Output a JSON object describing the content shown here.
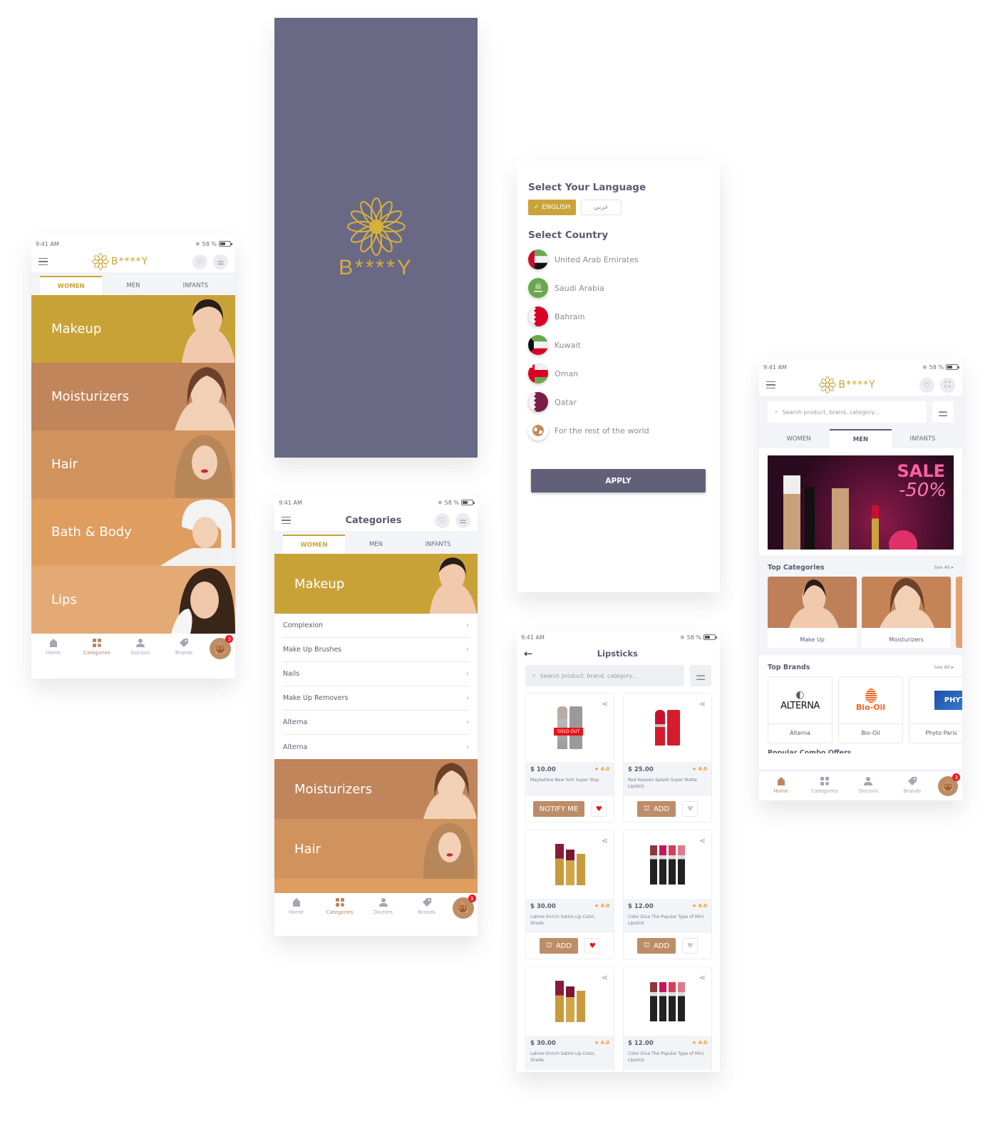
{
  "status": {
    "time": "9:41 AM",
    "battery": "58 %"
  },
  "brand": {
    "name": "B****Y",
    "gold": "#c9a43a",
    "splash_bg": "#696985"
  },
  "home_categories_screen": {
    "tabs": [
      "WOMEN",
      "MEN",
      "INFANTS"
    ],
    "active_tab": "WOMEN",
    "banners": [
      {
        "label": "Makeup",
        "color": "#c9a237"
      },
      {
        "label": "Moisturizers",
        "color": "#c0855b"
      },
      {
        "label": "Hair",
        "color": "#d1935d"
      },
      {
        "label": "Bath & Body",
        "color": "#df9d60"
      },
      {
        "label": "Lips",
        "color": "#e3aa75"
      }
    ]
  },
  "bottom_nav": {
    "items": [
      "Home",
      "Categories",
      "Doctors",
      "Brands"
    ],
    "cart_count": "3"
  },
  "categories_screen": {
    "title": "Categories",
    "tabs": [
      "WOMEN",
      "MEN",
      "INFANTS"
    ],
    "active_tab": "WOMEN",
    "top_banner": "Makeup",
    "subcategories": [
      "Complexion",
      "Make Up Brushes",
      "Nails",
      "Make Up Removers",
      "Alterna",
      "Alterna"
    ],
    "more_banners": [
      "Moisturizers",
      "Hair"
    ]
  },
  "language_screen": {
    "language_title": "Select Your Language",
    "languages": [
      {
        "label": "ENGLISH",
        "selected": true
      },
      {
        "label": "عربي",
        "selected": false
      }
    ],
    "country_title": "Select Country",
    "countries": [
      "United Arab Emirates",
      "Saudi Arabia",
      "Bahrain",
      "Kuwait",
      "Oman",
      "Qatar",
      "For the rest of the world"
    ],
    "apply_label": "APPLY"
  },
  "lipsticks_screen": {
    "title": "Lipsticks",
    "search_placeholder": "Search product, brand, category...",
    "products": [
      {
        "price": "$ 10.00",
        "rating": "4.0",
        "name": "Maybelline New York Super Stay",
        "action": "NOTIFY ME",
        "sold_out": true,
        "sold_out_label": "SOLD OUT",
        "favorite": true
      },
      {
        "price": "$ 25.00",
        "rating": "4.0",
        "name": "Red Heaven Splash Super Matte Lipstick",
        "action": "ADD",
        "sold_out": false,
        "favorite": false
      },
      {
        "price": "$ 30.00",
        "rating": "4.0",
        "name": "Lakme Enrich Satins Lip Color, Shade",
        "action": "ADD",
        "sold_out": false,
        "favorite": true
      },
      {
        "price": "$ 12.00",
        "rating": "4.0",
        "name": "Color Diva The Popular Type of Mini Lipstick",
        "action": "ADD",
        "sold_out": false,
        "favorite": false
      },
      {
        "price": "$ 30.00",
        "rating": "4.0",
        "name": "Lakme Enrich Satins Lip Color, Shade"
      },
      {
        "price": "$ 12.00",
        "rating": "4.0",
        "name": "Color Diva The Popular Type of Mini Lipstick"
      }
    ]
  },
  "home_screen": {
    "search_placeholder": "Search product, brand, category...",
    "tabs": [
      "WOMEN",
      "MEN",
      "INFANTS"
    ],
    "active_tab": "MEN",
    "promo": {
      "title": "SALE",
      "discount": "-50%"
    },
    "top_categories_title": "Top Categories",
    "see_all": "See All",
    "top_categories": [
      "Make Up",
      "Moisturizers"
    ],
    "top_brands_title": "Top Brands",
    "brands": [
      {
        "name": "Alterna",
        "logo_text": "ALTERNA"
      },
      {
        "name": "Bio-Oil",
        "logo_text": "Bio-Oil"
      },
      {
        "name": "Phyto Paris",
        "logo_text": "PHYTO"
      }
    ],
    "next_section": "Popular Combo Offers"
  }
}
